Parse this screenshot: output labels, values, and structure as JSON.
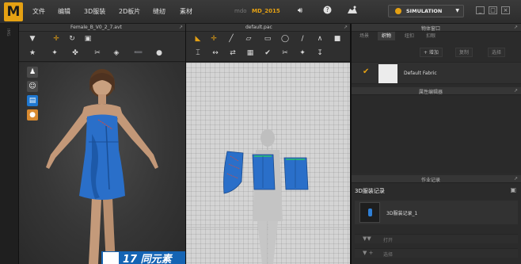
{
  "app": {
    "logo": "M",
    "menu": [
      "文件",
      "编辑",
      "3D服装",
      "2D板片",
      "缝纫",
      "素材"
    ],
    "title_prefix": "mdo",
    "title": "MD_2015",
    "icons": [
      "speaker-icon",
      "help-icon",
      "avatar-mode-icon"
    ],
    "simulation_label": "SIMULATION",
    "accent": "#e5a113"
  },
  "left_strip": {
    "label": "IMG"
  },
  "view3d": {
    "title": "Female_B_V0_2_7.avt",
    "toolbar_row1": [
      "down-arrow-icon",
      "move-icon",
      "rotate-icon",
      "scale-icon"
    ],
    "toolbar_row2": [
      "run-icon",
      "pin-icon",
      "tack-icon",
      "measure-icon",
      "cube-icon",
      "fold-icon",
      "steam-icon"
    ],
    "side_icons": [
      {
        "name": "avatar-show-icon",
        "color": "#4a4a4a"
      },
      {
        "name": "avatar-skin-icon",
        "color": "#4a4a4a"
      },
      {
        "name": "garment-show-icon",
        "color": "#1f78d1"
      },
      {
        "name": "face-icon",
        "color": "#d98a2f"
      }
    ],
    "garment_color": "#2a6fc9",
    "watermark_text": "17 同元素"
  },
  "view2d": {
    "title": "default.pac",
    "pieces": 4,
    "piece_color": "#2a6fc9"
  },
  "object_browser": {
    "title": "物体窗口",
    "tabs": [
      "场景",
      "织物",
      "纽扣",
      "扣眼"
    ],
    "active_tab": 1,
    "actions": [
      "+ 增加",
      "复制",
      "选择"
    ],
    "fabric_name": "Default Fabric"
  },
  "property_editor": {
    "title": "属性编辑器"
  },
  "history": {
    "title": "作业记录",
    "section_title": "3D服装记录",
    "item_label": "3D服装记录_1",
    "rows": [
      "打开",
      "选择"
    ]
  }
}
